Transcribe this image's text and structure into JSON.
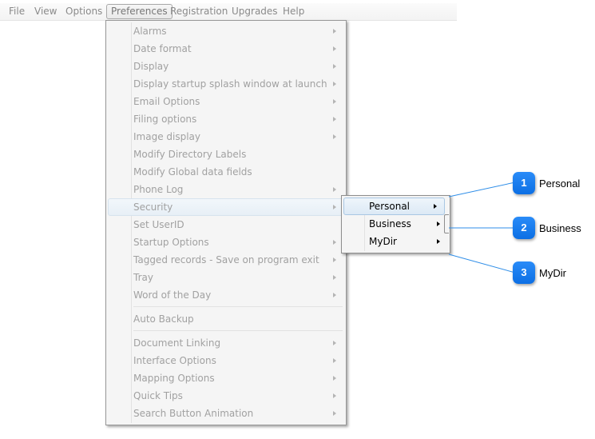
{
  "menubar": {
    "items": [
      "File",
      "View",
      "Options",
      "Preferences",
      "Registration",
      "Upgrades",
      "Help"
    ],
    "active": "Preferences"
  },
  "preferences_menu": {
    "items": [
      {
        "label": "Alarms",
        "submenu": true
      },
      {
        "label": "Date format",
        "submenu": true
      },
      {
        "label": "Display",
        "submenu": true
      },
      {
        "label": "Display startup splash window at launch",
        "submenu": true
      },
      {
        "label": "Email Options",
        "submenu": true
      },
      {
        "label": "Filing options",
        "submenu": true
      },
      {
        "label": "Image display",
        "submenu": true
      },
      {
        "label": "Modify Directory Labels",
        "submenu": false
      },
      {
        "label": "Modify Global data fields",
        "submenu": false
      },
      {
        "label": "Phone Log",
        "submenu": true
      },
      {
        "label": "Security",
        "submenu": true,
        "highlighted": true
      },
      {
        "label": "Set UserID",
        "submenu": false
      },
      {
        "label": "Startup Options",
        "submenu": true
      },
      {
        "label": "Tagged records - Save on program exit",
        "submenu": true
      },
      {
        "label": "Tray",
        "submenu": true
      },
      {
        "label": "Word of the Day",
        "submenu": true
      },
      {
        "label": "Auto Backup",
        "submenu": false
      },
      {
        "label": "Document Linking",
        "submenu": true
      },
      {
        "label": "Interface Options",
        "submenu": true
      },
      {
        "label": "Mapping Options",
        "submenu": true
      },
      {
        "label": "Quick Tips",
        "submenu": true
      },
      {
        "label": "Search Button Animation",
        "submenu": true
      }
    ]
  },
  "security_submenu": {
    "items": [
      {
        "label": "Personal",
        "highlighted": true
      },
      {
        "label": "Business"
      },
      {
        "label": "MyDir"
      }
    ]
  },
  "callouts": [
    {
      "number": "1",
      "label": "Personal"
    },
    {
      "number": "2",
      "label": "Business"
    },
    {
      "number": "3",
      "label": "MyDir"
    }
  ],
  "colors": {
    "callout_badge": "#1a7ff0",
    "callout_line": "#2f8ee8",
    "disabled_text": "#a1a1a1"
  }
}
